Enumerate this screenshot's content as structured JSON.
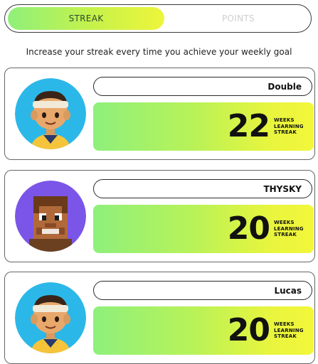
{
  "tabs": {
    "streak_label": "STREAK",
    "points_label": "POINTS"
  },
  "subtitle": "Increase your streak every time you achieve your weekly goal",
  "entries": [
    {
      "name": "Double",
      "streak": "22",
      "avatar": "boy-headband-avatar"
    },
    {
      "name": "THYSKY",
      "streak": "20",
      "avatar": "blocky-avatar"
    },
    {
      "name": "Lucas",
      "streak": "20",
      "avatar": "boy-headband-avatar"
    }
  ],
  "streak_label": {
    "line1": "WEEKS",
    "line2": "LEARNING",
    "line3": "STREAK"
  },
  "colors": {
    "gradient_start": "#8ff07a",
    "gradient_end": "#eef53a",
    "avatar_blue": "#2bb8e8",
    "avatar_purple": "#7a55e8"
  }
}
